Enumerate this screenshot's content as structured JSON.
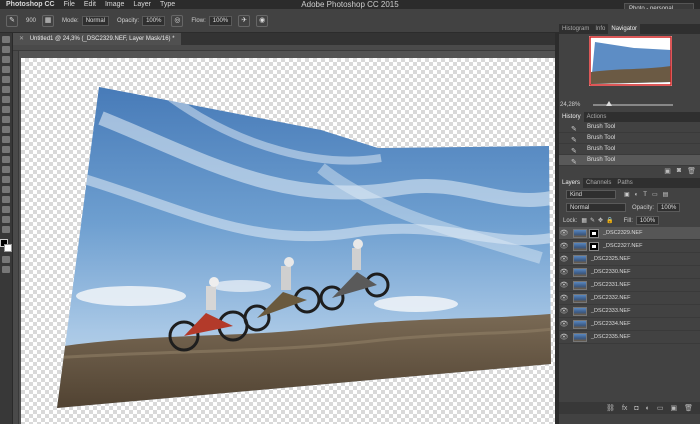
{
  "menubar": {
    "app_name": "Photoshop CC",
    "menus": [
      "File",
      "Edit",
      "Image",
      "Layer",
      "Type"
    ],
    "window_title": "Adobe Photoshop CC 2015",
    "workspace": "Photo - personal"
  },
  "options": {
    "brush_size": "900",
    "mode_label": "Mode:",
    "mode_value": "Normal",
    "opacity_label": "Opacity:",
    "opacity_value": "100%",
    "flow_label": "Flow:",
    "flow_value": "100%"
  },
  "document": {
    "tab_title": "Untitled1 @ 24,3% (_DSC2329.NEF, Layer Mask/16) *"
  },
  "navigator": {
    "tabs": [
      "Histogram",
      "Info",
      "Navigator"
    ],
    "zoom": "24,28%",
    "zoom_fraction": 0.2
  },
  "history": {
    "tabs": [
      "History",
      "Actions"
    ],
    "items": [
      "Brush Tool",
      "Brush Tool",
      "Brush Tool",
      "Brush Tool"
    ]
  },
  "layers": {
    "tabs": [
      "Layers",
      "Channels",
      "Paths"
    ],
    "kind_label": "Kind",
    "blend_mode": "Normal",
    "opacity_label": "Opacity:",
    "opacity_value": "100%",
    "lock_label": "Lock:",
    "fill_label": "Fill:",
    "fill_value": "100%",
    "items": [
      {
        "name": "_DSC2329.NEF",
        "mask": true,
        "selected": true
      },
      {
        "name": "_DSC2327.NEF",
        "mask": true,
        "selected": false
      },
      {
        "name": "_DSC2325.NEF",
        "mask": false,
        "selected": false
      },
      {
        "name": "_DSC2330.NEF",
        "mask": false,
        "selected": false
      },
      {
        "name": "_DSC2331.NEF",
        "mask": false,
        "selected": false
      },
      {
        "name": "_DSC2332.NEF",
        "mask": false,
        "selected": false
      },
      {
        "name": "_DSC2333.NEF",
        "mask": false,
        "selected": false
      },
      {
        "name": "_DSC2334.NEF",
        "mask": false,
        "selected": false
      },
      {
        "name": "_DSC2335.NEF",
        "mask": false,
        "selected": false
      }
    ]
  }
}
